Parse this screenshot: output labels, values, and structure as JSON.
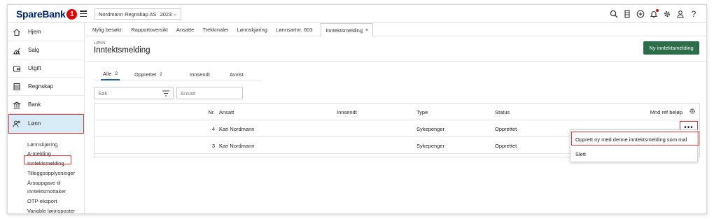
{
  "brand": {
    "name": "SpareBank",
    "badge": "1",
    "primary_color": "#002776",
    "accent_color": "#e60000",
    "button_color": "#2d6e4a",
    "active_bg": "#d7ecf7"
  },
  "topbar": {
    "company": "Nordmann Regnskap AS",
    "year": "2023",
    "icons": [
      "search-icon",
      "book-icon",
      "plus-circle-icon",
      "bell-icon",
      "gear-icon",
      "user-icon",
      "help-icon"
    ],
    "help_label": "?"
  },
  "sidebar": {
    "items": [
      {
        "label": "Hjem",
        "icon": "home-icon"
      },
      {
        "label": "Salg",
        "icon": "chart-icon"
      },
      {
        "label": "Utgift",
        "icon": "wallet-icon"
      },
      {
        "label": "Regnskap",
        "icon": "ledger-icon"
      },
      {
        "label": "Bank",
        "icon": "bank-icon"
      },
      {
        "label": "Lønn",
        "icon": "people-icon"
      }
    ],
    "sub_items": [
      "Lønnskjøring",
      "A-melding",
      "Inntektsmelding",
      "Tilleggsopplysninger",
      "Årsoppgave til",
      "inntektsmottaker",
      "OTP-eksport",
      "Variable lønnsposter"
    ]
  },
  "recent": {
    "label": "Nylig besøkt:",
    "items": [
      "Rapportoversikt",
      "Ansatte",
      "Trekkmaler",
      "Lønnskjøring",
      "Lønnsartnr. 603",
      "Inntektsmelding"
    ],
    "close": "×"
  },
  "header": {
    "breadcrumb": "LØNN",
    "title": "Inntektsmelding",
    "new_button": "Ny inntektsmelding"
  },
  "tabs": [
    {
      "label": "Alle",
      "count": "2"
    },
    {
      "label": "Opprettet",
      "count": "2"
    },
    {
      "label": "Innsendt",
      "count": ""
    },
    {
      "label": "Avvist",
      "count": ""
    }
  ],
  "filters": {
    "search_placeholder": "Søk",
    "employee_placeholder": "Ansatt"
  },
  "table": {
    "columns": {
      "nr": "Nr.",
      "ansatt": "Ansatt",
      "innsendt": "Innsendt",
      "type": "Type",
      "status": "Status",
      "belop": "Mnd ref beløp"
    },
    "rows": [
      {
        "nr": "4",
        "ansatt": "Kari Nordmann",
        "innsendt": "",
        "type": "Sykepenger",
        "status": "Opprettet"
      },
      {
        "nr": "3",
        "ansatt": "Kari Nordmann",
        "innsendt": "",
        "type": "Sykepenger",
        "status": "Opprettet"
      }
    ],
    "more_label": "•••"
  },
  "context_menu": {
    "items": [
      "Opprett ny med denne inntektsmelding som mal",
      "Slett"
    ]
  }
}
